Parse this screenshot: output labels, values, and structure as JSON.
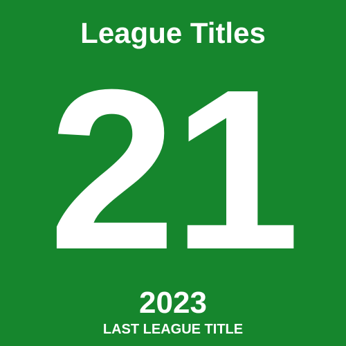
{
  "card": {
    "title": "League Titles",
    "count": "21",
    "year": "2023",
    "caption": "LAST LEAGUE TITLE",
    "background_color": "#16862d",
    "text_color": "#ffffff"
  }
}
